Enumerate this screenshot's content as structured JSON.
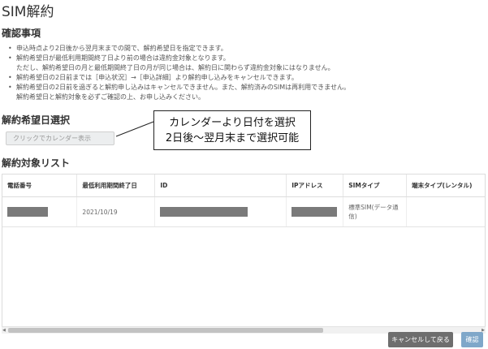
{
  "page": {
    "title": "SIM解約"
  },
  "confirm": {
    "heading": "確認事項",
    "items": [
      {
        "text": "申込時点より2日後から翌月末までの間で、解約希望日を指定できます。",
        "bullet": true
      },
      {
        "text": "解約希望日が最低利用期間終了日より前の場合は違約金対象となります。",
        "bullet": true
      },
      {
        "text": "ただし、解約希望日の月と最低期間終了日の月が同じ場合は、解約日に関わらず違約金対象にはなりません。",
        "bullet": false
      },
      {
        "text": "解約希望日の2日前までは［申込状況］→［申込詳細］より解約申し込みをキャンセルできます。",
        "bullet": true
      },
      {
        "text": "解約希望日の2日前を過ぎると解約申し込みはキャンセルできません。また、解約済みのSIMは再利用できません。",
        "bullet": true
      },
      {
        "text": "解約希望日と解約対象を必ずご確認の上、お申し込みください。",
        "bullet": false
      }
    ]
  },
  "date_select": {
    "heading": "解約希望日選択",
    "placeholder": "クリックでカレンダー表示"
  },
  "callout": {
    "line1": "カレンダーより日付を選択",
    "line2": "2日後～翌月末まで選択可能"
  },
  "target_list": {
    "heading": "解約対象リスト",
    "columns": [
      "電話番号",
      "最低利用期間終了日",
      "ID",
      "IPアドレス",
      "SIMタイプ",
      "端末タイプ(レンタル)"
    ],
    "rows": [
      {
        "phone": "",
        "min_end": "2021/10/19",
        "id": "",
        "ip": "",
        "sim_type": "標準SIM(データ通信)",
        "device": ""
      }
    ]
  },
  "buttons": {
    "cancel": "キャンセルして戻る",
    "confirm": "確認"
  },
  "colors": {
    "cancel_button": "#6e6e6e",
    "confirm_button": "#7fa7c9",
    "redaction": "#7a7a7a"
  }
}
